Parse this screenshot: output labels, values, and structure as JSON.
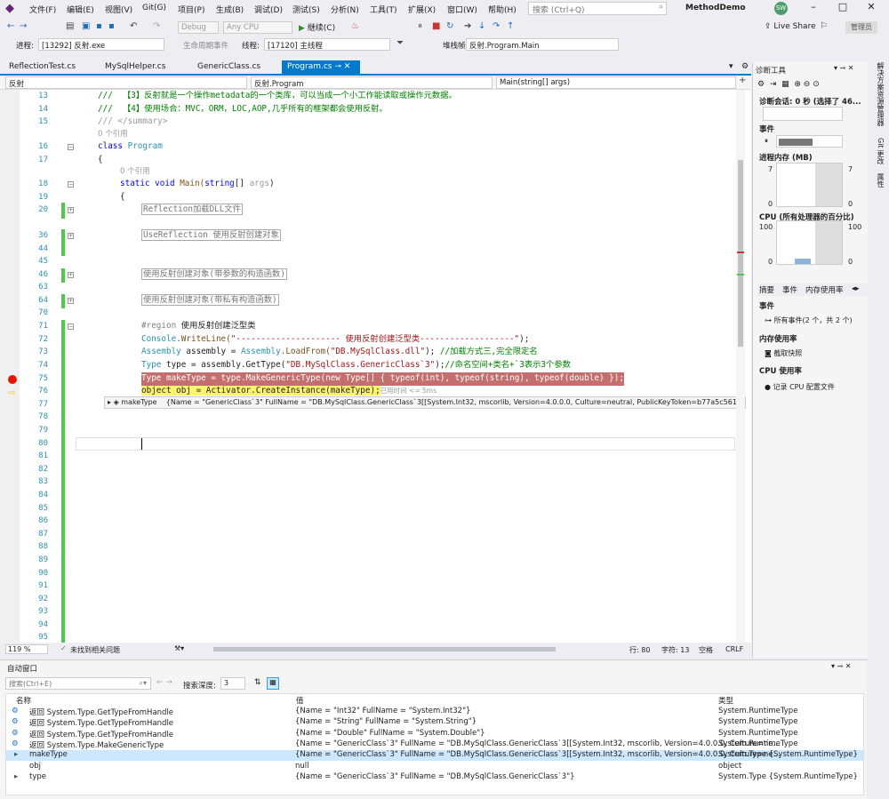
{
  "title_bar": {
    "menu": [
      "文件(F)",
      "编辑(E)",
      "视图(V)",
      "Git(G)",
      "项目(P)",
      "生成(B)",
      "调试(D)",
      "测试(S)",
      "分析(N)",
      "工具(T)",
      "扩展(X)",
      "窗口(W)",
      "帮助(H)"
    ],
    "search_placeholder": "搜索 (Ctrl+Q)",
    "project_name": "MethodDemo",
    "avatar_initials": "SW"
  },
  "toolbar": {
    "config": "Debug",
    "platform": "Any CPU",
    "continue_label": "继续(C)",
    "live_share": "Live Share",
    "admin_label": "管理员"
  },
  "debug_location": {
    "process_label": "进程:",
    "process_value": "[13292] 反射.exe",
    "lifecycle_label": "生命周期事件",
    "thread_label": "线程:",
    "thread_value": "[17120] 主线程",
    "stack_label": "堆栈帧:",
    "stack_value": "反射.Program.Main"
  },
  "tabs": [
    "ReflectionTest.cs",
    "MySqlHelper.cs",
    "GenericClass.cs",
    "Program.cs"
  ],
  "active_tab": "Program.cs",
  "nav": {
    "project": "反射",
    "class": "反射.Program",
    "member": "Main(string[] args)"
  },
  "code": {
    "l13": "///  【3】反射就是一个操作metadata的一个类库，可以当成一个小工作能读取或操作元数据。",
    "l14": "///  【4】使用场合：MVC，ORM，LOC,AOP,几乎所有的框架都会使用反射。",
    "l15": "/// </summary>",
    "ref0": "0 个引用",
    "l16a": "class",
    "l16b": "Program",
    "l17": "{",
    "ref1": "0 个引用",
    "l18a": "static void",
    "l18b": "Main(",
    "l18c": "string",
    "l18d": "[] ",
    "l18e": "args",
    "l18f": ")",
    "l19": "{",
    "l20": "Reflection加载DLL文件",
    "l36": "UseReflection 使用反射创建对象",
    "l46": "使用反射创建对象(带参数的构造函数)",
    "l64": "使用反射创建对象(带私有构造函数)",
    "l71a": "#region",
    "l71b": "使用反射创建泛型类",
    "l72a": "Console",
    "l72b": ".WriteLine(",
    "l72c": "\"--------------------- 使用反射创建泛型类-------------------\"",
    "l72d": ");",
    "l73a": "Assembly",
    "l73b": " assembly = ",
    "l73c": "Assembly",
    "l73d": ".LoadFrom(",
    "l73e": "\"DB.MySqlClass.dll\"",
    "l73f": "); ",
    "l73g": "//加载方式三,完全限定名",
    "l74a": "Type",
    "l74b": " type = assembly.GetType(",
    "l74c": "\"DB.MySqlClass.GenericClass`3\"",
    "l74d": ");",
    "l74e": "//命名空间+类名+`3表示3个参数",
    "l75": "Type makeType = type.MakeGenericType(new Type[] { typeof(int), typeof(string), typeof(double) });",
    "l76": "object obj = Activator.CreateInstance(makeType);",
    "elapsed": "已用时间 <= 5ms"
  },
  "datatip": {
    "name": "makeType",
    "value": "{Name = \"GenericClass`3\" FullName = \"DB.MySqlClass.GenericClass`3[[System.Int32, mscorlib, Version=4.0.0.0, Culture=neutral, PublicKeyToken=b77a5c561934e089..."
  },
  "line_numbers": [
    "13",
    "14",
    "15",
    "16",
    "17",
    "18",
    "19",
    "20",
    "36",
    "44",
    "45",
    "46",
    "63",
    "64",
    "70",
    "71",
    "72",
    "73",
    "74",
    "75",
    "76",
    "77",
    "78",
    "79",
    "80",
    "81",
    "82",
    "83",
    "84",
    "85",
    "86",
    "87",
    "88",
    "89",
    "90",
    "91",
    "92",
    "93",
    "94",
    "95"
  ],
  "status_bar": {
    "zoom": "119 %",
    "issues": "未找到相关问题",
    "line": "行: 80",
    "char": "字符: 13",
    "space": "空格",
    "eol": "CRLF"
  },
  "diagnostics": {
    "title": "诊断工具",
    "session": "诊断会话: 0 秒 (选择了 46...",
    "events_title": "事件",
    "mem_title": "进程内存 (MB)",
    "mem_max": "7",
    "mem_min": "0",
    "cpu_title": "CPU (所有处理器的百分比)",
    "cpu_max": "100",
    "cpu_min": "0",
    "tabs": [
      "摘要",
      "事件",
      "内存使用率"
    ],
    "events_header": "事件",
    "all_events": "所有事件(2 个，共 2 个)",
    "mem_usage_header": "内存使用率",
    "snapshot": "截取快照",
    "cpu_usage_header": "CPU 使用率",
    "record_cpu": "记录 CPU 配置文件"
  },
  "side_tabs": [
    "解决方案资源管理器",
    "Git 更改",
    "属性"
  ],
  "autos": {
    "title": "自动窗口",
    "search_placeholder": "搜索(Ctrl+E)",
    "depth_label": "搜索深度:",
    "depth_value": "3",
    "headers": [
      "名称",
      "值",
      "类型"
    ],
    "rows": [
      {
        "name": "返回 System.Type.GetTypeFromHandle",
        "value": "{Name = \"Int32\" FullName = \"System.Int32\"}",
        "type": "System.RuntimeType"
      },
      {
        "name": "返回 System.Type.GetTypeFromHandle",
        "value": "{Name = \"String\" FullName = \"System.String\"}",
        "type": "System.RuntimeType"
      },
      {
        "name": "返回 System.Type.GetTypeFromHandle",
        "value": "{Name = \"Double\" FullName = \"System.Double\"}",
        "type": "System.RuntimeType"
      },
      {
        "name": "返回 System.Type.MakeGenericType",
        "value": "{Name = \"GenericClass`3\" FullName = \"DB.MySqlClass.GenericClass`3[[System.Int32, mscorlib, Version=4.0.0.0, Culture=ne...",
        "type": "System.RuntimeType"
      },
      {
        "name": "makeType",
        "value": "{Name = \"GenericClass`3\" FullName = \"DB.MySqlClass.GenericClass`3[[System.Int32, mscorlib, Version=4.0.0.0, Culture=ne...",
        "type": "System.Type {System.RuntimeType}"
      },
      {
        "name": "obj",
        "value": "null",
        "type": "object"
      },
      {
        "name": "type",
        "value": "{Name = \"GenericClass`3\" FullName = \"DB.MySqlClass.GenericClass`3\"}",
        "type": "System.Type {System.RuntimeType}"
      }
    ]
  }
}
